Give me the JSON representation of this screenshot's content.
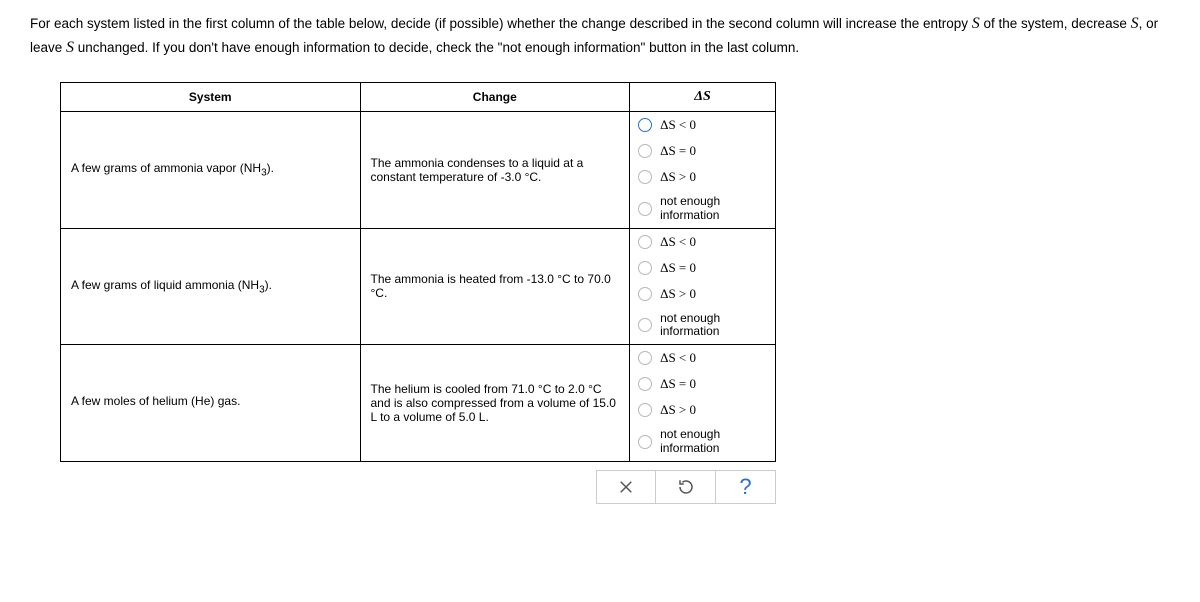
{
  "instructions": {
    "part1": "For each system listed in the first column of the table below, decide (if possible) whether the change described in the second column will increase the entropy ",
    "S1": "S",
    "part2": " of the system, decrease ",
    "S2": "S",
    "part3": ", or leave ",
    "S3": "S",
    "part4": " unchanged. If you don't have enough information to decide, check the \"not enough information\" button in the last column."
  },
  "headers": {
    "system": "System",
    "change": "Change",
    "deltaS": "ΔS"
  },
  "rows": [
    {
      "system_pre": "A few grams of ammonia vapor (NH",
      "system_sub": "3",
      "system_post": ").",
      "change": "The ammonia condenses to a liquid at a constant temperature of -3.0 °C.",
      "highlight_first": true
    },
    {
      "system_pre": "A few grams of liquid ammonia (NH",
      "system_sub": "3",
      "system_post": ").",
      "change": "The ammonia is heated from -13.0 °C to 70.0 °C.",
      "highlight_first": false
    },
    {
      "system_pre": "A few moles of helium (He) gas.",
      "system_sub": "",
      "system_post": "",
      "change": "The helium is cooled from 71.0 °C to 2.0 °C and is also compressed from a volume of 15.0 L to a volume of 5.0 L.",
      "highlight_first": false
    }
  ],
  "options": {
    "lt": "ΔS < 0",
    "eq": "ΔS = 0",
    "gt": "ΔS > 0",
    "nei1": "not enough",
    "nei2": "information"
  },
  "toolbar": {
    "close": "×",
    "reset": "↺",
    "help": "?"
  }
}
